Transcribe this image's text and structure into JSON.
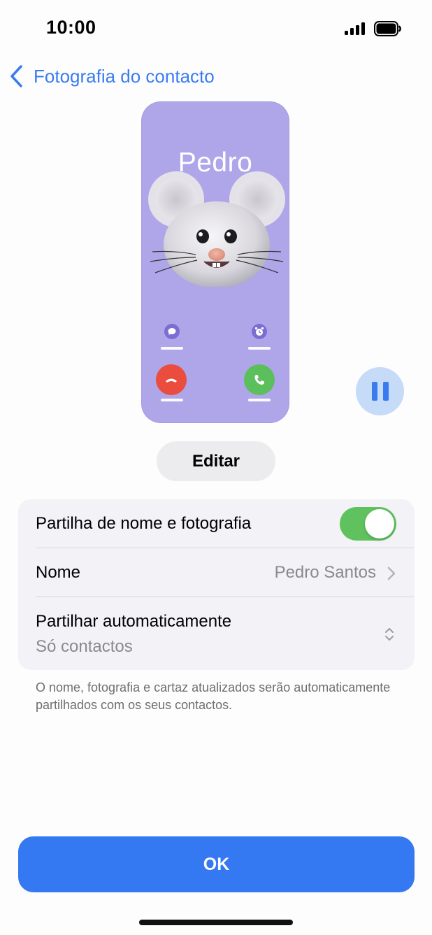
{
  "status_bar": {
    "time": "10:00"
  },
  "nav": {
    "back_label": "Fotografia do contacto"
  },
  "poster": {
    "contact_first_name": "Pedro",
    "background_color": "#afa6ea",
    "decline_color": "#ea4c3d",
    "accept_color": "#5bbf5b"
  },
  "edit_label": "Editar",
  "settings": {
    "share_toggle": {
      "label": "Partilha de nome e fotografia",
      "on": true
    },
    "name_row": {
      "label": "Nome",
      "value": "Pedro Santos"
    },
    "auto_share_row": {
      "label": "Partilhar automaticamente",
      "value": "Só contactos"
    }
  },
  "footnote": "O nome, fotografia e cartaz atualizados serão automaticamente partilhados com os seus contactos.",
  "ok_label": "OK",
  "accent_color": "#3478f2"
}
